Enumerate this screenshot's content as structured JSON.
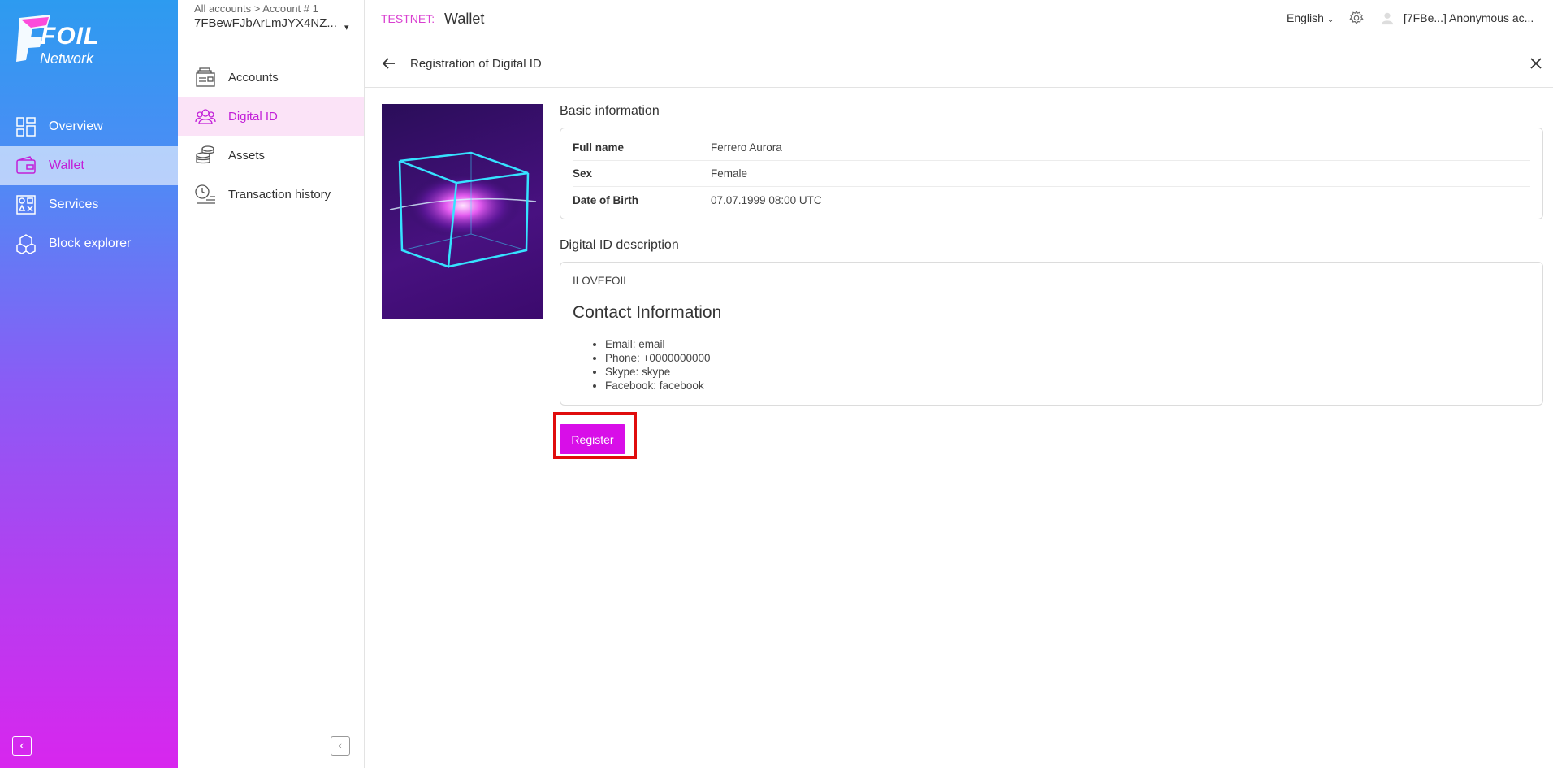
{
  "brand": {
    "name": "FOIL",
    "sub": "Network"
  },
  "main_nav": {
    "items": [
      {
        "label": "Overview",
        "icon": "grid-icon"
      },
      {
        "label": "Wallet",
        "icon": "wallet-icon",
        "active": true
      },
      {
        "label": "Services",
        "icon": "services-icon"
      },
      {
        "label": "Block explorer",
        "icon": "cubes-icon"
      }
    ]
  },
  "account": {
    "path": "All accounts > Account # 1",
    "id": "7FBewFJbArLmJYX4NZ...",
    "caret": "▾"
  },
  "sub_nav": {
    "items": [
      {
        "label": "Accounts",
        "icon": "wallet-stack-icon"
      },
      {
        "label": "Digital ID",
        "icon": "people-icon",
        "active": true
      },
      {
        "label": "Assets",
        "icon": "coins-icon"
      },
      {
        "label": "Transaction history",
        "icon": "history-icon"
      }
    ]
  },
  "header": {
    "network": "TESTNET:",
    "title": "Wallet",
    "language": "English",
    "user": "[7FBe...] Anonymous ac..."
  },
  "content": {
    "title": "Registration of Digital ID"
  },
  "basic_info": {
    "title": "Basic information",
    "rows": [
      {
        "key": "Full name",
        "value": "Ferrero Aurora"
      },
      {
        "key": "Sex",
        "value": "Female"
      },
      {
        "key": "Date of Birth",
        "value": "07.07.1999 08:00 UTC"
      }
    ]
  },
  "description": {
    "title": "Digital ID description",
    "line": "ILOVEFOIL",
    "heading": "Contact Information",
    "items": [
      "Email: email",
      "Phone: +0000000000",
      "Skype: skype",
      "Facebook: facebook"
    ]
  },
  "actions": {
    "register": "Register"
  },
  "colors": {
    "accent": "#d80ee8",
    "highlight": "#e00d0d",
    "active_bg": "#fbe3f7"
  }
}
